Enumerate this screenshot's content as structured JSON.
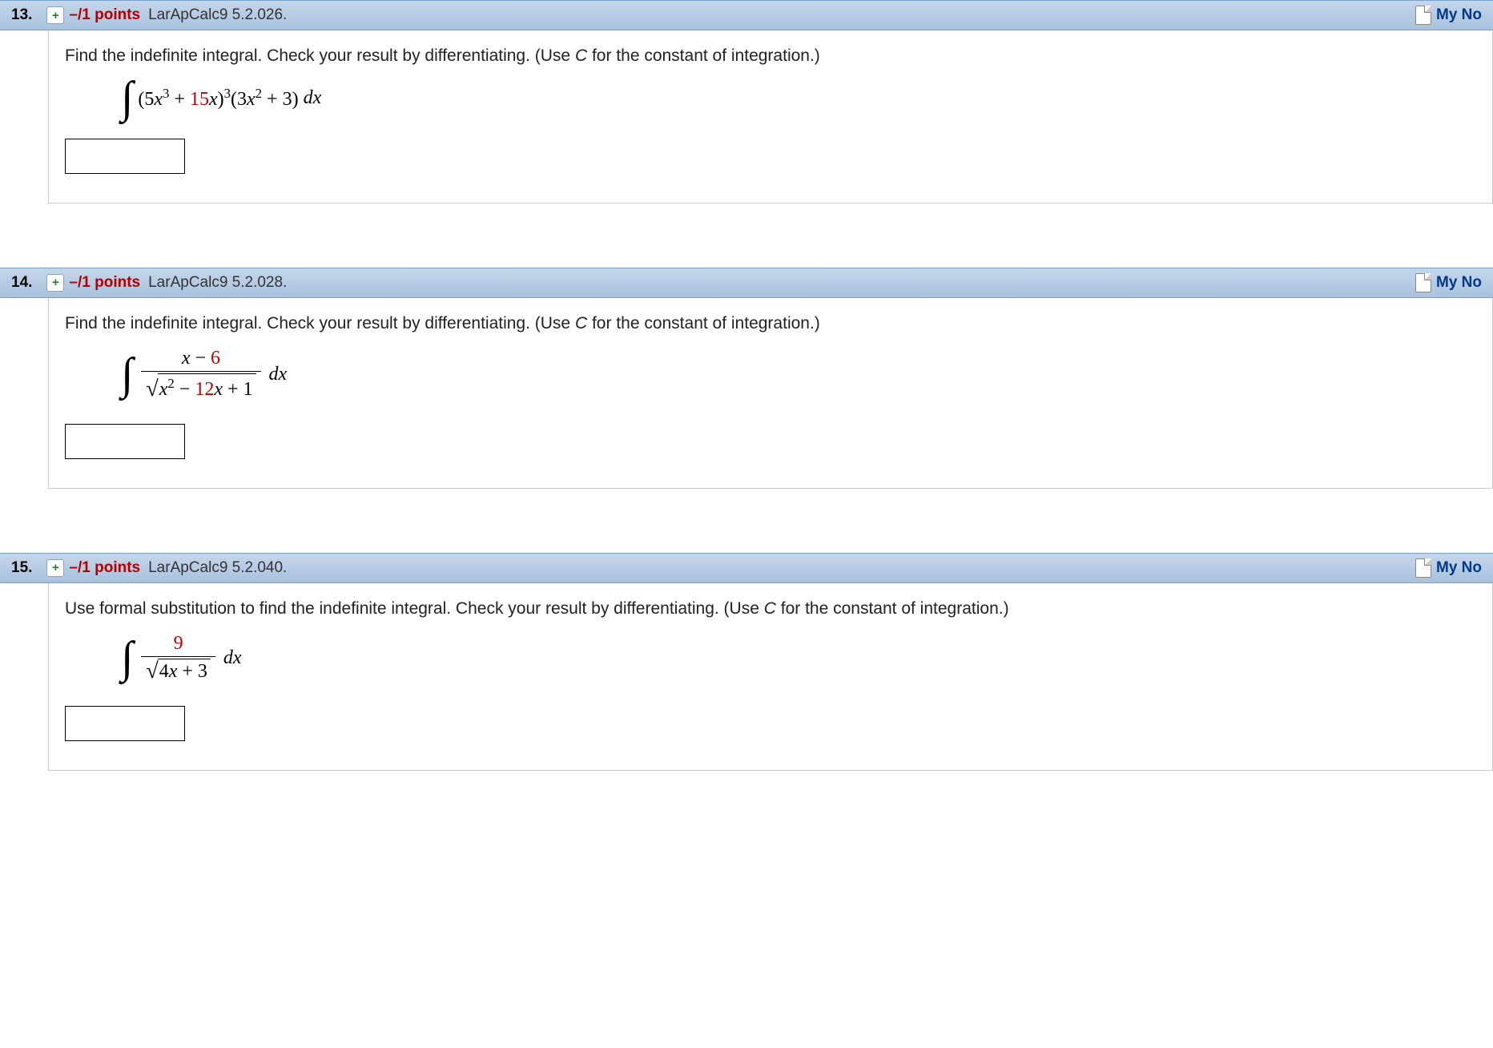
{
  "notes_label": "My No",
  "questions": [
    {
      "number": "13.",
      "points": "–/1 points",
      "source": "LarApCalc9 5.2.026.",
      "prompt_prefix": "Find the indefinite integral. Check your result by differentiating. (Use ",
      "prompt_var": "C",
      "prompt_suffix": " for the constant of integration.)",
      "math": {
        "type": "poly",
        "a": "5",
        "b": "15",
        "c": "3",
        "d": "3"
      }
    },
    {
      "number": "14.",
      "points": "–/1 points",
      "source": "LarApCalc9 5.2.028.",
      "prompt_prefix": "Find the indefinite integral. Check your result by differentiating. (Use ",
      "prompt_var": "C",
      "prompt_suffix": " for the constant of integration.)",
      "math": {
        "type": "fracsqrt",
        "num_a": "6",
        "den_a": "12",
        "den_b": "1"
      }
    },
    {
      "number": "15.",
      "points": "–/1 points",
      "source": "LarApCalc9 5.2.040.",
      "prompt_prefix": "Use formal substitution to find the indefinite integral. Check your result by differentiating. (Use ",
      "prompt_var": "C",
      "prompt_suffix": " for the constant of integration.)",
      "math": {
        "type": "fracsqrt2",
        "num": "9",
        "den_a": "4",
        "den_b": "3"
      }
    }
  ]
}
